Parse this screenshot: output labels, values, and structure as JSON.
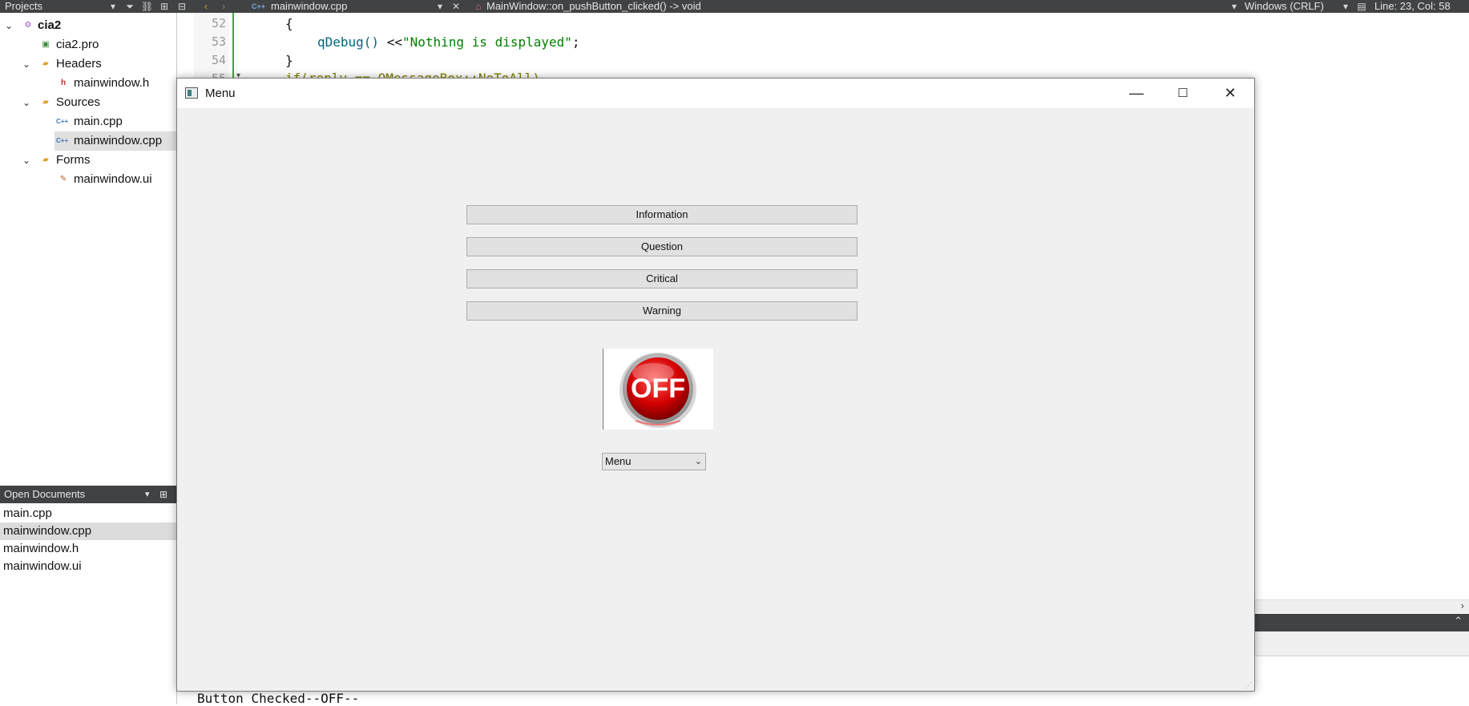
{
  "toolbar": {
    "projects_label": "Projects",
    "file_name": "mainwindow.cpp",
    "function_name": "MainWindow::on_pushButton_clicked() -> void",
    "line_ending": "Windows (CRLF)",
    "cursor_pos": "Line: 23, Col: 58"
  },
  "project_tree": {
    "root": "cia2",
    "pro_file": "cia2.pro",
    "headers_label": "Headers",
    "header_file": "mainwindow.h",
    "sources_label": "Sources",
    "source_main": "main.cpp",
    "source_mainwindow": "mainwindow.cpp",
    "forms_label": "Forms",
    "form_file": "mainwindow.ui"
  },
  "open_documents": {
    "title": "Open Documents",
    "items": [
      "main.cpp",
      "mainwindow.cpp",
      "mainwindow.h",
      "mainwindow.ui"
    ]
  },
  "editor": {
    "line_numbers": [
      "52",
      "53",
      "54",
      "55"
    ],
    "line52": "{",
    "line53_fn": "qDebug()",
    "line53_op": " <<",
    "line53_str": "\"Nothing is displayed\"",
    "line53_end": ";",
    "line54": "}",
    "line55": "if(reply == QMessageBox::NoToAll)"
  },
  "output": {
    "text": "Button Checked--OFF--"
  },
  "menu_window": {
    "title": "Menu",
    "buttons": {
      "information": "Information",
      "question": "Question",
      "critical": "Critical",
      "warning": "Warning"
    },
    "off_image_text": "OFF",
    "combo_value": "Menu"
  }
}
